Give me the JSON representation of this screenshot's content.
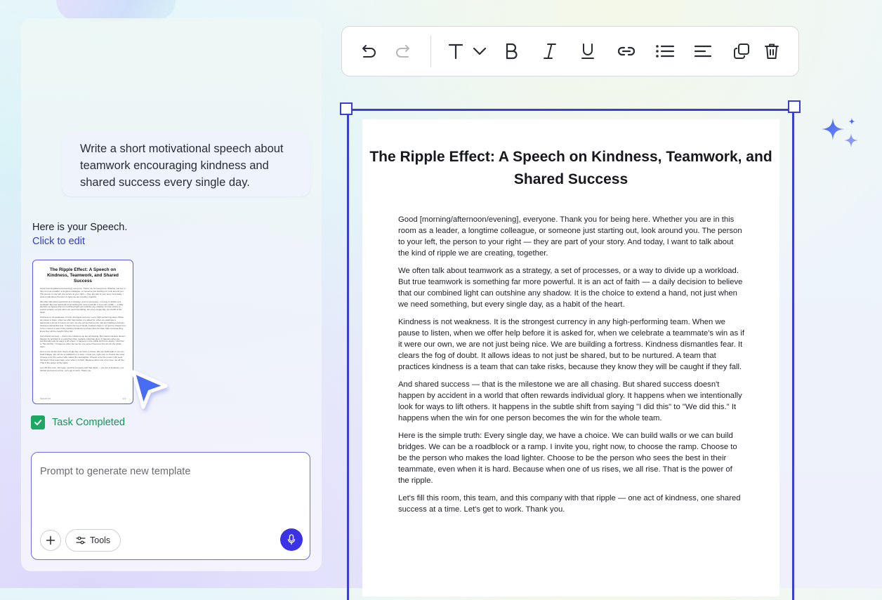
{
  "chat": {
    "user_prompt": "Write a short motivational speech about teamwork encouraging kindness and shared success every single day.",
    "reply": "Here is your Speech.",
    "edit_link": "Click to edit",
    "task_status": "Task Completed"
  },
  "thumbnail": {
    "title": "The Ripple Effect: A Speech on Kindness, Teamwork, and Shared Success",
    "footer_left": "Speech 1/1",
    "footer_right": "1/1"
  },
  "prompt": {
    "placeholder": "Prompt to generate new template",
    "tools_label": "Tools"
  },
  "toolbar": {
    "buttons": [
      "undo-icon",
      "redo-icon",
      "text-style-icon",
      "chevron-down-icon",
      "bold-icon",
      "italic-icon",
      "underline-icon",
      "link-icon",
      "bulleted-list-icon",
      "align-left-icon",
      "duplicate-icon",
      "delete-icon"
    ]
  },
  "document": {
    "title": "The Ripple Effect: A Speech on Kindness, Teamwork, and Shared Success",
    "paragraphs": [
      "Good [morning/afternoon/evening], everyone. Thank you for being here. Whether you are in this room as a leader, a longtime colleague, or someone just starting out, look around you. The person to your left, the person to your right — they are part of your story. And today, I want to talk about the kind of ripple we are creating, together.",
      "We often talk about teamwork as a strategy, a set of processes, or a way to divide up a workload. But true teamwork is something far more powerful. It is an act of faith — a daily decision to believe that our combined light can outshine any shadow. It is the choice to extend a hand, not just when we need something, but every single day, as a habit of the heart.",
      "Kindness is not weakness. It is the strongest currency in any high-performing team. When we pause to listen, when we offer help before it is asked for, when we celebrate a teammate's win as if it were our own, we are not just being nice. We are building a fortress. Kindness dismantles fear. It clears the fog of doubt. It allows ideas to not just be shared, but to be nurtured. A team that practices kindness is a team that can take risks, because they know they will be caught if they fall.",
      "And shared success — that is the milestone we are all chasing. But shared success doesn't happen by accident in a world that often rewards individual glory. It happens when we intentionally look for ways to lift others. It happens in the subtle shift from saying \"I did this\" to \"We did this.\" It happens when the win for one person becomes the win for the whole team.",
      "Here is the simple truth: Every single day, we have a choice. We can build walls or we can build bridges. We can be a roadblock or a ramp. I invite you, right now, to choose the ramp. Choose to be the person who makes the load lighter. Choose to be the person who sees the best in their teammate, even when it is hard. Because when one of us rises, we all rise. That is the power of the ripple.",
      "Let's fill this room, this team, and this company with that ripple — one act of kindness, one shared success at a time. Let's get to work. Thank you."
    ]
  },
  "colors": {
    "accent": "#3b3fd0",
    "success": "#1ca862",
    "mic": "#3a33e6"
  }
}
